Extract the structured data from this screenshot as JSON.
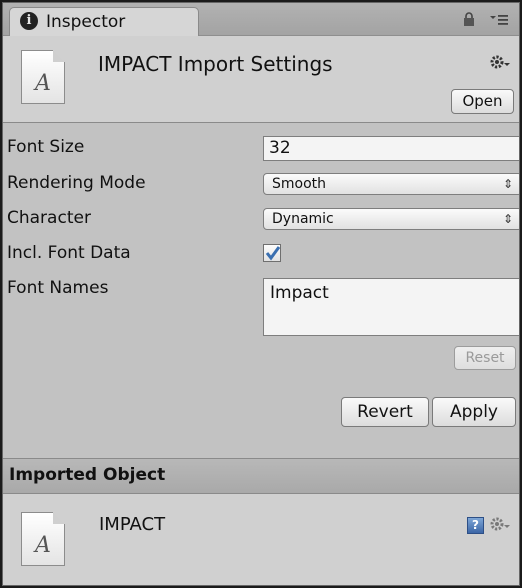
{
  "tab": {
    "label": "Inspector",
    "icon": "info-icon"
  },
  "header": {
    "title": "IMPACT Import Settings",
    "file_icon_glyph": "A",
    "open_label": "Open"
  },
  "properties": {
    "font_size_label": "Font Size",
    "font_size_value": "32",
    "rendering_mode_label": "Rendering Mode",
    "rendering_mode_value": "Smooth",
    "character_label": "Character",
    "character_value": "Dynamic",
    "incl_font_data_label": "Incl. Font Data",
    "incl_font_data_checked": true,
    "font_names_label": "Font Names",
    "font_names_value": "Impact",
    "reset_label": "Reset"
  },
  "actions": {
    "revert_label": "Revert",
    "apply_label": "Apply"
  },
  "imported": {
    "section_title": "Imported Object",
    "name": "IMPACT",
    "file_icon_glyph": "A"
  },
  "colors": {
    "panel_bg": "#c2c2c2",
    "header_bg": "#d0d0d0",
    "field_bg": "#f4f4f4",
    "check_blue": "#3a6fb0"
  }
}
